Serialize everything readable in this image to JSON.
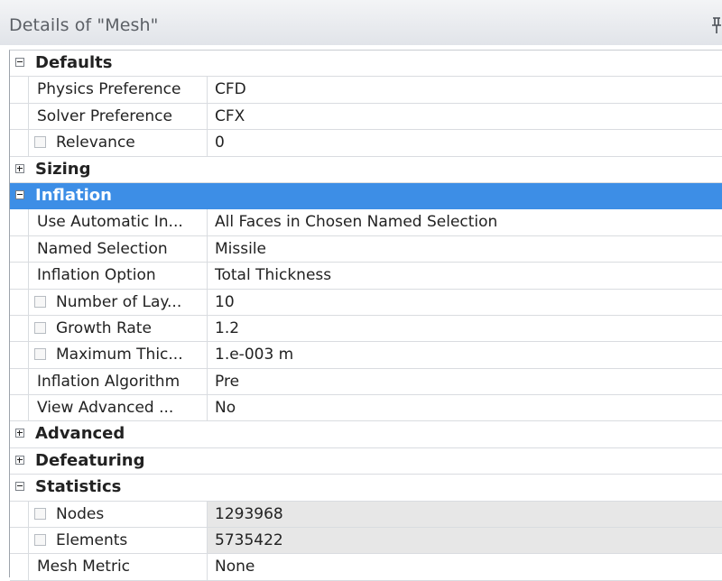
{
  "window": {
    "title": "Details of \"Mesh\""
  },
  "colors": {
    "selection": "#3d8ee6",
    "readonly_value_bg": "#e7e7e7",
    "title_text": "#5c6066"
  },
  "defaults": {
    "label": "Defaults",
    "expanded": true,
    "rows": [
      {
        "name": "Physics Preference",
        "value": "CFD",
        "checkbox": false
      },
      {
        "name": "Solver Preference",
        "value": "CFX",
        "checkbox": false
      },
      {
        "name": "Relevance",
        "value": "0",
        "checkbox": true
      }
    ]
  },
  "sizing": {
    "label": "Sizing",
    "expanded": false
  },
  "inflation": {
    "label": "Inflation",
    "expanded": true,
    "selected": true,
    "rows": [
      {
        "name": "Use Automatic In...",
        "value": "All Faces in Chosen Named Selection",
        "checkbox": false
      },
      {
        "name": "Named Selection",
        "value": "Missile",
        "checkbox": false
      },
      {
        "name": "Inflation Option",
        "value": "Total Thickness",
        "checkbox": false
      },
      {
        "name": "Number of Lay...",
        "value": "10",
        "checkbox": true
      },
      {
        "name": "Growth Rate",
        "value": "1.2",
        "checkbox": true
      },
      {
        "name": "Maximum Thic...",
        "value": "1.e-003 m",
        "checkbox": true
      },
      {
        "name": "Inflation Algorithm",
        "value": "Pre",
        "checkbox": false
      },
      {
        "name": "View Advanced ...",
        "value": "No",
        "checkbox": false
      }
    ]
  },
  "advanced": {
    "label": "Advanced",
    "expanded": false
  },
  "defeaturing": {
    "label": "Defeaturing",
    "expanded": false
  },
  "statistics": {
    "label": "Statistics",
    "expanded": true,
    "rows": [
      {
        "name": "Nodes",
        "value": "1293968",
        "checkbox": true,
        "readonly": true
      },
      {
        "name": "Elements",
        "value": "5735422",
        "checkbox": true,
        "readonly": true
      },
      {
        "name": "Mesh Metric",
        "value": "None",
        "checkbox": false
      }
    ]
  }
}
